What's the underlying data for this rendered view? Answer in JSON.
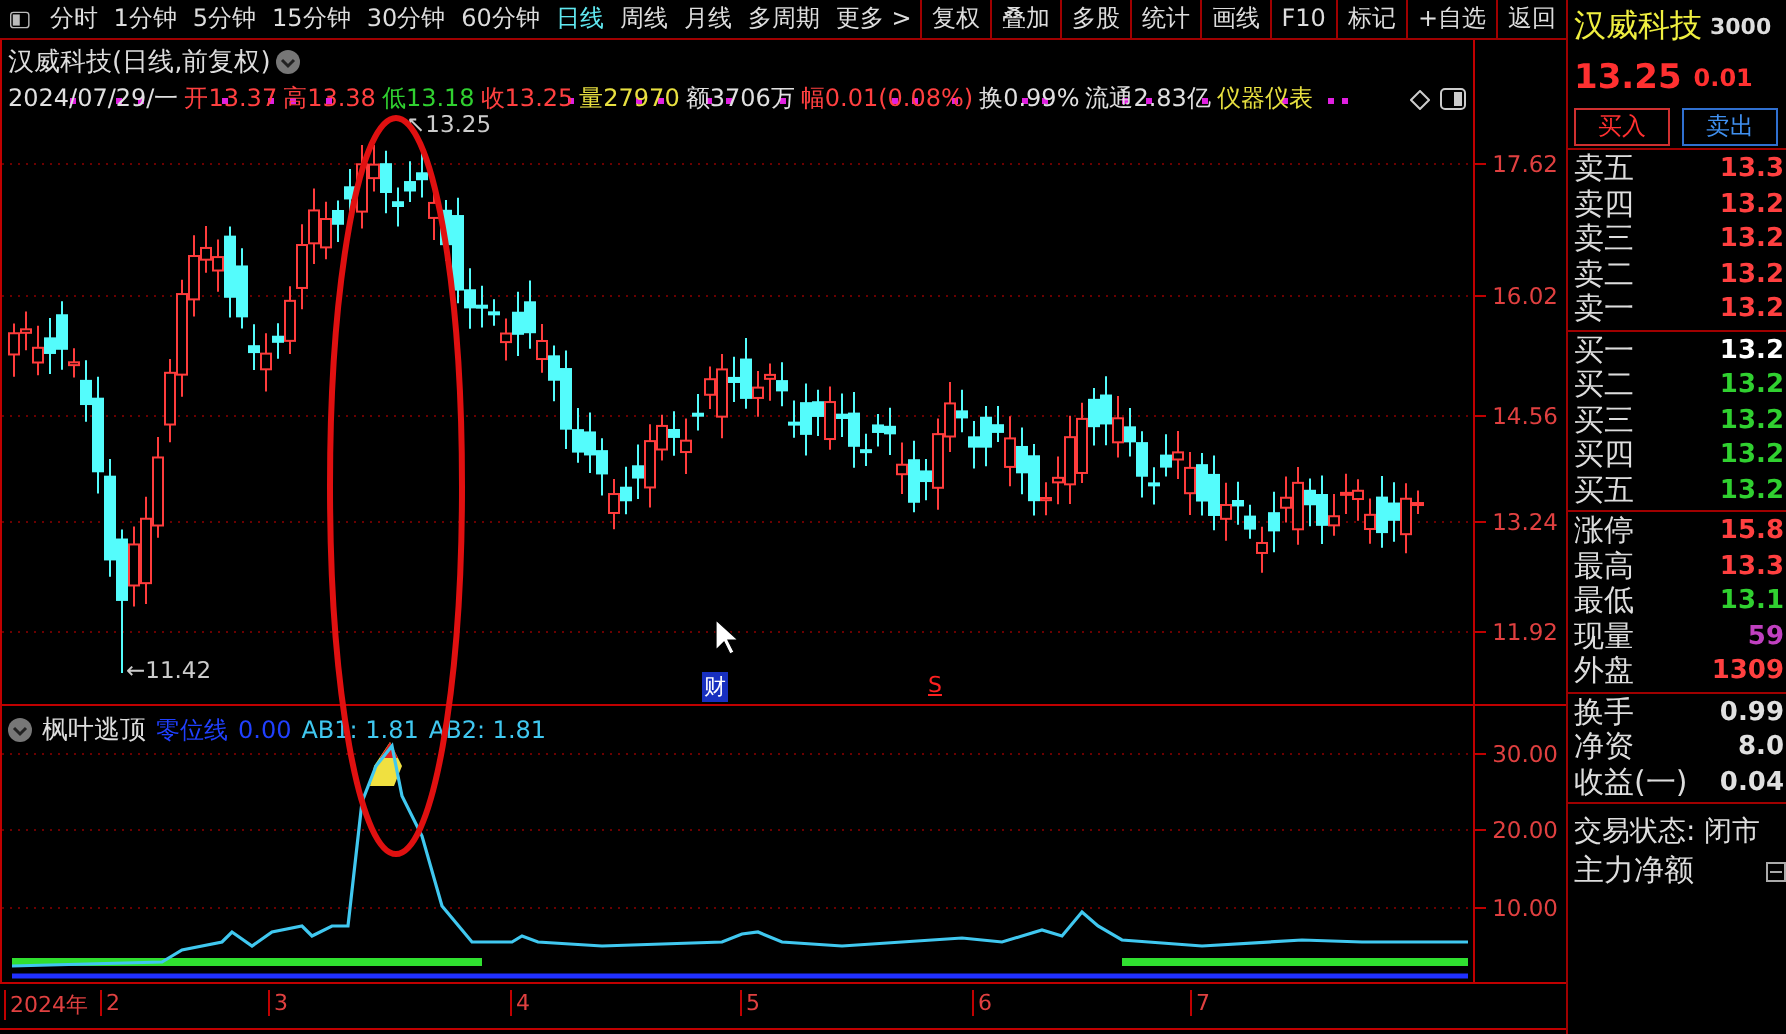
{
  "toolbar": {
    "periods": [
      {
        "label": "分时",
        "selected": false
      },
      {
        "label": "1分钟",
        "selected": false
      },
      {
        "label": "5分钟",
        "selected": false
      },
      {
        "label": "15分钟",
        "selected": false
      },
      {
        "label": "30分钟",
        "selected": false
      },
      {
        "label": "60分钟",
        "selected": false
      },
      {
        "label": "日线",
        "selected": true
      },
      {
        "label": "周线",
        "selected": false
      },
      {
        "label": "月线",
        "selected": false
      },
      {
        "label": "多周期",
        "selected": false
      }
    ],
    "more": "更多 >",
    "actions": [
      "复权",
      "叠加",
      "多股",
      "统计",
      "画线",
      "F10",
      "标记",
      "+自选",
      "返回"
    ]
  },
  "chart": {
    "title": "汉威科技(日线,前复权)",
    "quote": [
      {
        "text": "2024/07/29/一",
        "color": "#e0e0e0"
      },
      {
        "text": "开13.37",
        "color": "#ff4040"
      },
      {
        "text": "高13.38",
        "color": "#ff4040"
      },
      {
        "text": "低13.18",
        "color": "#30d030"
      },
      {
        "text": "收13.25",
        "color": "#ff4040"
      },
      {
        "text": "量27970",
        "color": "#e8e040"
      },
      {
        "text": "额3706万",
        "color": "#e0e0e0"
      },
      {
        "text": "幅0.01(0.08%)",
        "color": "#ff4040"
      },
      {
        "text": "换0.99%",
        "color": "#e0e0e0"
      },
      {
        "text": "流通2.83亿",
        "color": "#e0e0e0"
      },
      {
        "text": "仪器仪表",
        "color": "#e8e040"
      }
    ],
    "price_axis": [
      "17.62",
      "16.02",
      "14.56",
      "13.24",
      "11.92"
    ],
    "peak_label": "↖13.25",
    "low_label": "←11.42",
    "markers": [
      {
        "text": "财",
        "kind": "finance"
      },
      {
        "text": "S",
        "kind": "sell"
      }
    ]
  },
  "indicator": {
    "name": "枫叶逃顶",
    "values": [
      {
        "text": "零位线",
        "color": "#2040ff"
      },
      {
        "text": "0.00",
        "color": "#2040ff"
      },
      {
        "text": "AB1: 1.81",
        "color": "#40c8f0"
      },
      {
        "text": "AB2: 1.81",
        "color": "#40c8f0"
      }
    ],
    "axis": [
      "30.00",
      "20.00",
      "10.00"
    ]
  },
  "date_axis": [
    "2024年",
    "2",
    "3",
    "4",
    "5",
    "6",
    "7"
  ],
  "quote_panel": {
    "name": "汉威科技",
    "code": "3000",
    "price": "13.25",
    "change": "0.01",
    "buttons": [
      {
        "label": "买入",
        "kind": "buy"
      },
      {
        "label": "卖出",
        "kind": "sell"
      }
    ],
    "asks": [
      {
        "label": "卖五",
        "value": "13.3",
        "color": "#ff4040"
      },
      {
        "label": "卖四",
        "value": "13.2",
        "color": "#ff4040"
      },
      {
        "label": "卖三",
        "value": "13.2",
        "color": "#ff4040"
      },
      {
        "label": "卖二",
        "value": "13.2",
        "color": "#ff4040"
      },
      {
        "label": "卖一",
        "value": "13.2",
        "color": "#ff4040"
      }
    ],
    "bids": [
      {
        "label": "买一",
        "value": "13.2",
        "color": "#ffffff"
      },
      {
        "label": "买二",
        "value": "13.2",
        "color": "#30d030"
      },
      {
        "label": "买三",
        "value": "13.2",
        "color": "#30d030"
      },
      {
        "label": "买四",
        "value": "13.2",
        "color": "#30d030"
      },
      {
        "label": "买五",
        "value": "13.2",
        "color": "#30d030"
      }
    ],
    "stats": [
      {
        "label": "涨停",
        "value": "15.8",
        "color": "#ff4040"
      },
      {
        "label": "最高",
        "value": "13.3",
        "color": "#ff4040"
      },
      {
        "label": "最低",
        "value": "13.1",
        "color": "#30d030"
      },
      {
        "label": "现量",
        "value": "59",
        "color": "#c040c0"
      },
      {
        "label": "外盘",
        "value": "1309",
        "color": "#ff4040"
      }
    ],
    "finance": [
      {
        "label": "换手",
        "value": "0.99",
        "color": "#e0e0e0"
      },
      {
        "label": "净资",
        "value": "8.0",
        "color": "#e0e0e0"
      },
      {
        "label": "收益(一)",
        "value": "0.04",
        "color": "#e0e0e0"
      }
    ],
    "status": "交易状态: 闭市",
    "main_flow": "主力净额"
  }
}
